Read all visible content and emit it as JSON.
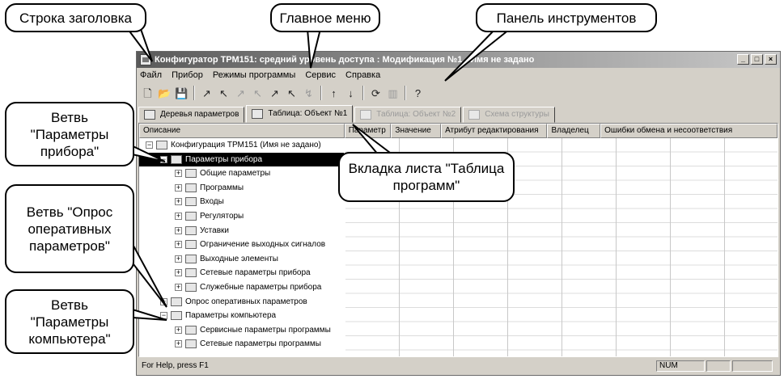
{
  "callouts": {
    "title_bar": "Строка заголовка",
    "main_menu": "Главное меню",
    "toolbar": "Панель инструментов",
    "branch_device_params": "Ветвь \"Параметры прибора\"",
    "branch_operative_poll": "Ветвь \"Опрос оперативных параметров\"",
    "branch_computer_params": "Ветвь \"Параметры компьютера\"",
    "sheet_tab": "Вкладка листа \"Таблица программ\""
  },
  "window": {
    "title": "Конфигуратор ТРМ151: средний уровень доступа : Модификация №1 - Имя не задано",
    "buttons": [
      "_",
      "□",
      "×"
    ]
  },
  "menu": [
    "Файл",
    "Прибор",
    "Режимы программы",
    "Сервис",
    "Справка"
  ],
  "toolbar_icons": [
    {
      "icon": "new-document-icon",
      "glyph": "🗋",
      "enabled": true
    },
    {
      "icon": "open-folder-icon",
      "glyph": "📂",
      "enabled": true
    },
    {
      "icon": "save-icon",
      "glyph": "💾",
      "enabled": true
    },
    {
      "icon": "write-device-icon",
      "glyph": "↗",
      "enabled": true
    },
    {
      "icon": "read-device-icon",
      "glyph": "↖",
      "enabled": true
    },
    {
      "icon": "write-all-icon",
      "glyph": "↗",
      "enabled": false
    },
    {
      "icon": "read-all-icon",
      "glyph": "↖",
      "enabled": false
    },
    {
      "icon": "write-selected-icon",
      "glyph": "↗",
      "enabled": true
    },
    {
      "icon": "read-selected-icon",
      "glyph": "↖",
      "enabled": true
    },
    {
      "icon": "compare-icon",
      "glyph": "↯",
      "enabled": false
    },
    {
      "icon": "sort-up-icon",
      "glyph": "↑",
      "enabled": true
    },
    {
      "icon": "sort-down-icon",
      "glyph": "↓",
      "enabled": true
    },
    {
      "icon": "refresh-icon",
      "glyph": "⟳",
      "enabled": true
    },
    {
      "icon": "grid-icon",
      "glyph": "▥",
      "enabled": false
    },
    {
      "icon": "help-icon",
      "glyph": "?",
      "enabled": true
    }
  ],
  "tabs": [
    {
      "label": "Деревья параметров",
      "active": false,
      "faded": false
    },
    {
      "label": "Таблица: Объект №1",
      "active": true,
      "faded": false
    },
    {
      "label": "Таблица: Объект №2",
      "active": false,
      "faded": true
    },
    {
      "label": "Схема структуры",
      "active": false,
      "faded": true
    }
  ],
  "columns": [
    "Описание",
    "Параметр",
    "Значение",
    "Атрибут редактирования",
    "Владелец",
    "Ошибки обмена и несоответствия"
  ],
  "tree": [
    {
      "label": "Конфигурация ТРМ151 (Имя не задано)",
      "level": 0,
      "expander": "−",
      "icon": "device-icon",
      "selected": false
    },
    {
      "label": "Параметры прибора",
      "level": 1,
      "expander": "−",
      "icon": "folder-icon",
      "selected": true
    },
    {
      "label": "Общие параметры",
      "level": 2,
      "expander": "+",
      "icon": "folder-icon",
      "selected": false
    },
    {
      "label": "Программы",
      "level": 2,
      "expander": "+",
      "icon": "folder-icon",
      "selected": false
    },
    {
      "label": "Входы",
      "level": 2,
      "expander": "+",
      "icon": "folder-icon",
      "selected": false
    },
    {
      "label": "Регуляторы",
      "level": 2,
      "expander": "+",
      "icon": "folder-icon",
      "selected": false
    },
    {
      "label": "Уставки",
      "level": 2,
      "expander": "+",
      "icon": "folder-icon",
      "selected": false
    },
    {
      "label": "Ограничение выходных сигналов",
      "level": 2,
      "expander": "+",
      "icon": "folder-icon",
      "selected": false
    },
    {
      "label": "Выходные элементы",
      "level": 2,
      "expander": "+",
      "icon": "folder-icon",
      "selected": false
    },
    {
      "label": "Сетевые параметры прибора",
      "level": 2,
      "expander": "+",
      "icon": "network-icon",
      "selected": false
    },
    {
      "label": "Служебные параметры прибора",
      "level": 2,
      "expander": "+",
      "icon": "service-icon",
      "selected": false
    },
    {
      "label": "Опрос оперативных параметров",
      "level": 1,
      "expander": "+",
      "icon": "folder-icon",
      "selected": false
    },
    {
      "label": "Параметры компьютера",
      "level": 1,
      "expander": "−",
      "icon": "computer-icon",
      "selected": false
    },
    {
      "label": "Сервисные параметры программы",
      "level": 2,
      "expander": "+",
      "icon": "window-icon",
      "selected": false
    },
    {
      "label": "Сетевые параметры программы",
      "level": 2,
      "expander": "+",
      "icon": "network-icon",
      "selected": false
    }
  ],
  "status": {
    "text": "For Help, press F1",
    "num": "NUM"
  }
}
